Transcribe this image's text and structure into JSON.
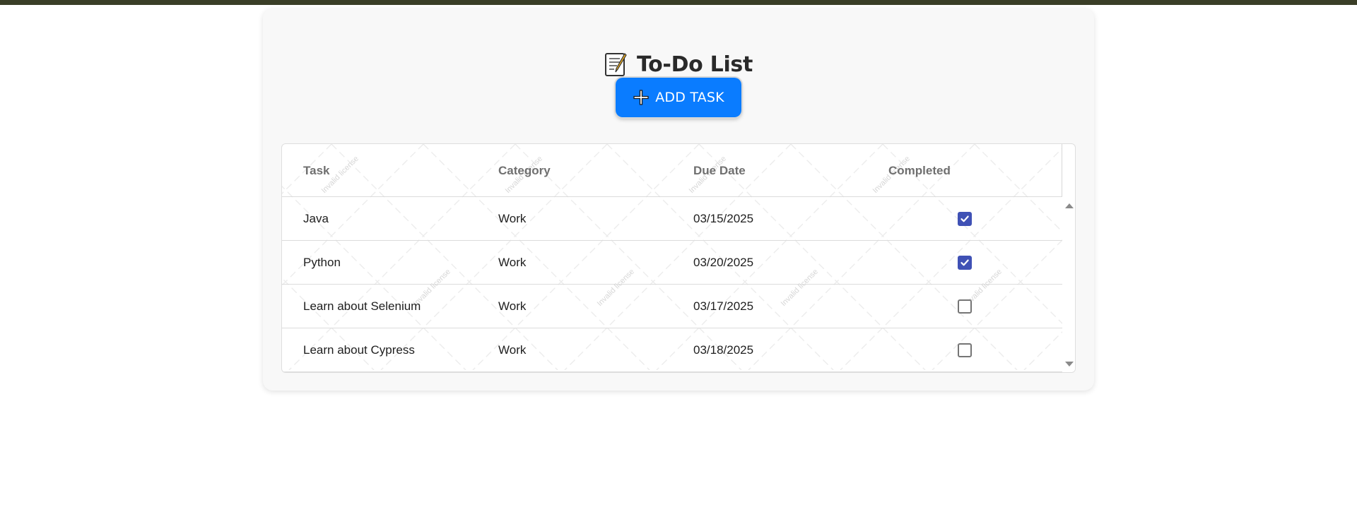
{
  "app": {
    "title": "To-Do List",
    "title_icon": "memo-icon",
    "add_button_label": "ADD TASK",
    "add_button_icon": "plus-icon",
    "accent_color": "#0a7cff",
    "checkbox_color": "#3f51b5"
  },
  "table": {
    "columns": [
      "Task",
      "Category",
      "Due Date",
      "Completed"
    ],
    "rows": [
      {
        "task": "Java",
        "category": "Work",
        "due": "03/15/2025",
        "completed": true
      },
      {
        "task": "Python",
        "category": "Work",
        "due": "03/20/2025",
        "completed": true
      },
      {
        "task": "Learn about Selenium",
        "category": "Work",
        "due": "03/17/2025",
        "completed": false
      },
      {
        "task": "Learn about Cypress",
        "category": "Work",
        "due": "03/18/2025",
        "completed": false
      }
    ]
  },
  "watermark": {
    "text": "Invalid license"
  }
}
